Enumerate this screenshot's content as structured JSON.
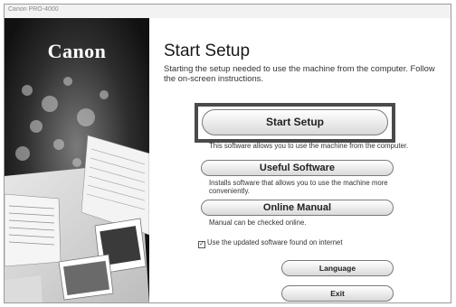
{
  "window": {
    "title": "Canon PRO-4000"
  },
  "brand": {
    "logo_text": "Canon"
  },
  "main": {
    "title": "Start Setup",
    "subtitle": "Starting the setup needed to use the machine from the computer. Follow the on-screen instructions."
  },
  "buttons": {
    "start_setup": {
      "label": "Start Setup",
      "desc": "This software allows you to use the machine from the computer."
    },
    "useful_software": {
      "label": "Useful Software",
      "desc": "Installs software that allows you to use the machine more conveniently."
    },
    "online_manual": {
      "label": "Online Manual",
      "desc": "Manual can be checked online."
    },
    "language": {
      "label": "Language"
    },
    "exit": {
      "label": "Exit"
    }
  },
  "checkbox": {
    "label": "Use the updated software found on internet",
    "checked": true,
    "mark": "✓"
  },
  "colors": {
    "highlight_border": "#4a4a4a",
    "left_panel": "#1a1a1a"
  }
}
